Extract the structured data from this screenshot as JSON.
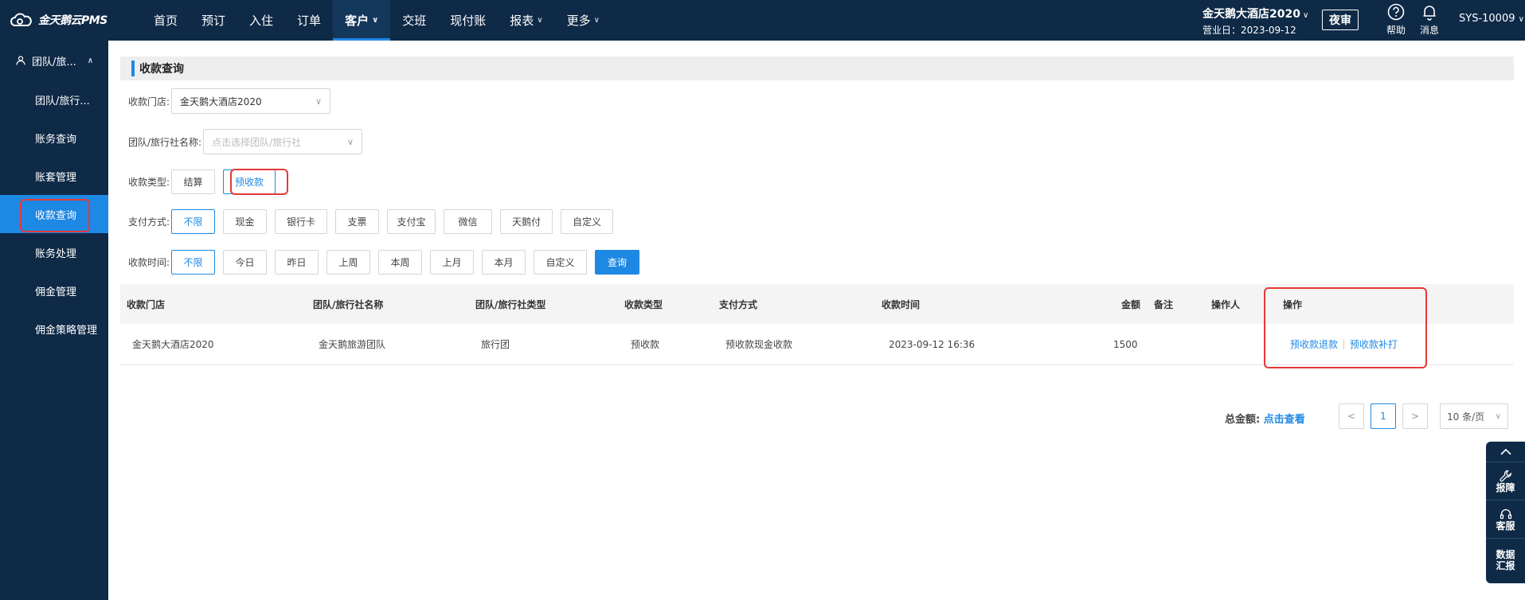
{
  "app": {
    "logo_text": "金天鹅云PMS"
  },
  "nav": {
    "items": [
      {
        "label": "首页",
        "has_menu": false
      },
      {
        "label": "预订",
        "has_menu": false
      },
      {
        "label": "入住",
        "has_menu": false
      },
      {
        "label": "订单",
        "has_menu": false
      },
      {
        "label": "客户",
        "has_menu": true,
        "active": true
      },
      {
        "label": "交班",
        "has_menu": false
      },
      {
        "label": "现付账",
        "has_menu": false
      },
      {
        "label": "报表",
        "has_menu": true
      },
      {
        "label": "更多",
        "has_menu": true
      }
    ]
  },
  "header": {
    "hotel_name": "金天鹅大酒店2020",
    "business_date": "营业日：2023-09-12",
    "night_audit": "夜审",
    "help": "帮助",
    "messages": "消息",
    "user": "SYS-10009"
  },
  "sidebar": {
    "group": "团队/旅...",
    "items": [
      {
        "label": "团队/旅行..."
      },
      {
        "label": "账务查询"
      },
      {
        "label": "账套管理"
      },
      {
        "label": "收款查询",
        "active": true
      },
      {
        "label": "账务处理"
      },
      {
        "label": "佣金管理"
      },
      {
        "label": "佣金策略管理"
      }
    ]
  },
  "page": {
    "title": "收款查询",
    "filters": {
      "store_label": "收款门店:",
      "store_value": "金天鹅大酒店2020",
      "agency_label": "团队/旅行社名称:",
      "agency_placeholder": "点击选择团队/旅行社",
      "type_label": "收款类型:",
      "type_options": [
        "结算",
        "预收款"
      ],
      "type_selected": "预收款",
      "pay_label": "支付方式:",
      "pay_options": [
        "不限",
        "现金",
        "银行卡",
        "支票",
        "支付宝",
        "微信",
        "天鹅付",
        "自定义"
      ],
      "pay_selected": "不限",
      "time_label": "收款时间:",
      "time_options": [
        "不限",
        "今日",
        "昨日",
        "上周",
        "本周",
        "上月",
        "本月",
        "自定义"
      ],
      "time_selected": "不限",
      "query_button": "查询"
    },
    "table": {
      "headers": {
        "store": "收款门店",
        "agency": "团队/旅行社名称",
        "agency_type": "团队/旅行社类型",
        "collect_type": "收款类型",
        "pay_method": "支付方式",
        "collect_time": "收款时间",
        "amount": "金额",
        "remark": "备注",
        "operator": "操作人",
        "actions": "操作"
      },
      "rows": [
        {
          "store": "金天鹅大酒店2020",
          "agency": "金天鹅旅游团队",
          "agency_type": "旅行团",
          "collect_type": "预收款",
          "pay_method": "预收款现金收款",
          "collect_time": "2023-09-12 16:36",
          "amount": "1500",
          "remark": "",
          "operator": "",
          "action_refund": "预收款退款",
          "action_reprint": "预收款补打"
        }
      ]
    },
    "footer": {
      "total_label": "总金额:",
      "total_link": "点击查看",
      "current_page": "1",
      "page_size": "10 条/页"
    }
  },
  "float_bar": {
    "report_issue": "报障",
    "service": "客服",
    "data_report": "数据汇报"
  },
  "colors": {
    "nav_bg": "#0f2a47",
    "accent": "#1e88e5",
    "highlight": "#e53935"
  }
}
